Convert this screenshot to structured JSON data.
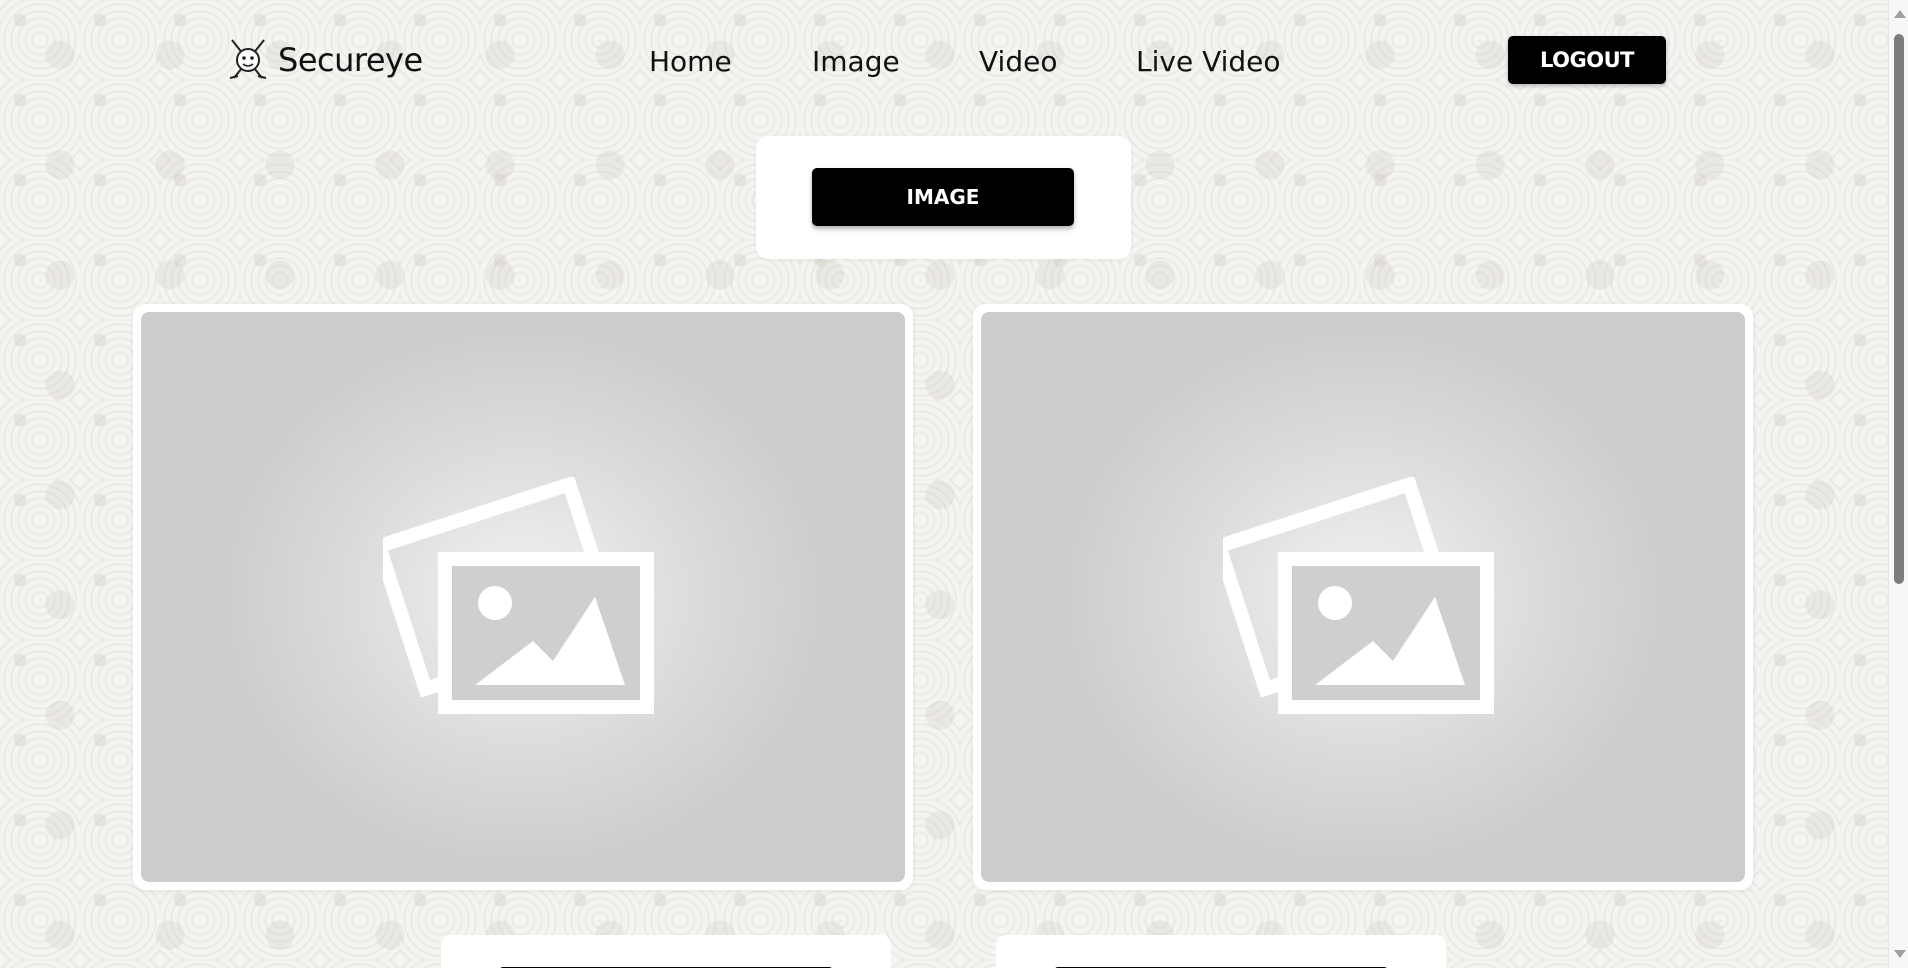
{
  "brand": {
    "name": "Secureye"
  },
  "nav": {
    "links": [
      {
        "label": "Home"
      },
      {
        "label": "Image"
      },
      {
        "label": "Video"
      },
      {
        "label": "Live Video"
      }
    ],
    "logout_label": "LOGOUT"
  },
  "mode": {
    "button_label": "IMAGE"
  },
  "icons": {
    "logo": "mask-swords-icon",
    "placeholder": "image-placeholder-icon"
  },
  "colors": {
    "button_bg": "#000000",
    "button_text": "#ffffff",
    "card_bg": "#ffffff",
    "placeholder_bg": "#cccccc"
  }
}
